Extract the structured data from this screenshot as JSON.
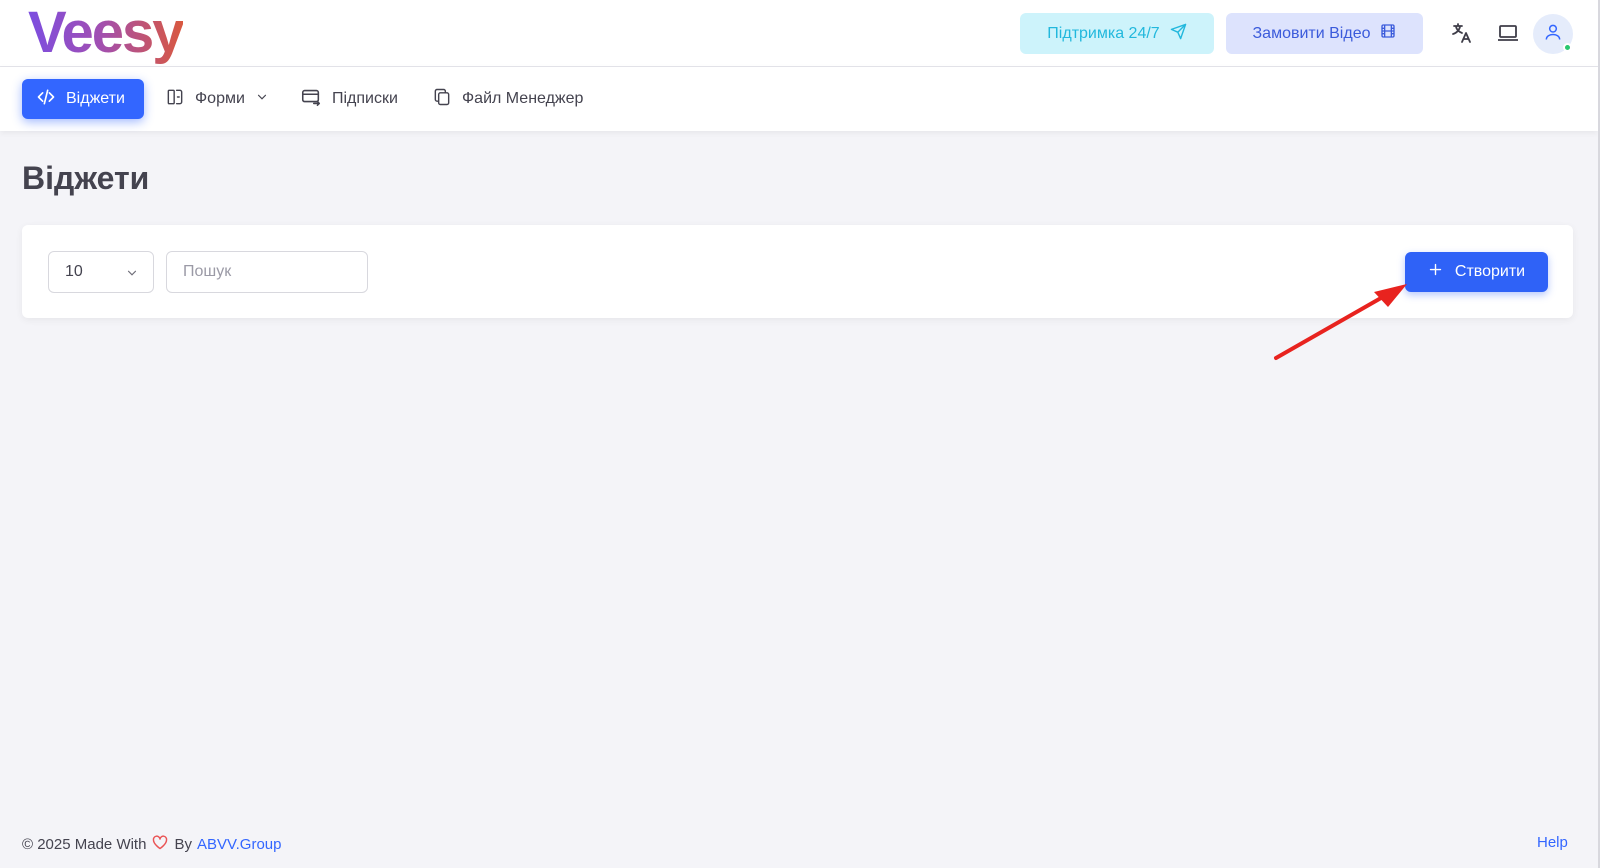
{
  "brand": {
    "logo_text": "Veesy"
  },
  "header": {
    "support_label": "Підтримка 24/7",
    "order_video_label": "Замовити Відео",
    "icons": [
      "translate-icon",
      "laptop-icon",
      "user-icon"
    ]
  },
  "nav": {
    "items": [
      {
        "label": "Віджети",
        "icon": "code-icon",
        "active": true
      },
      {
        "label": "Форми",
        "icon": "form-icon",
        "has_dropdown": true
      },
      {
        "label": "Підписки",
        "icon": "card-transfer-icon"
      },
      {
        "label": "Файл Менеджер",
        "icon": "copy-files-icon"
      }
    ]
  },
  "page": {
    "title": "Віджети"
  },
  "toolbar": {
    "page_size": "10",
    "search_placeholder": "Пошук",
    "create_label": "Створити"
  },
  "footer": {
    "prefix": "© 2025 Made With",
    "by": "By",
    "company": "ABVV.Group",
    "help": "Help"
  },
  "colors": {
    "primary": "#2f62f7",
    "support_bg": "#cdf3fb",
    "support_text": "#22b8dd",
    "video_bg": "#dde3fd",
    "annotation_arrow": "#e8231f"
  }
}
